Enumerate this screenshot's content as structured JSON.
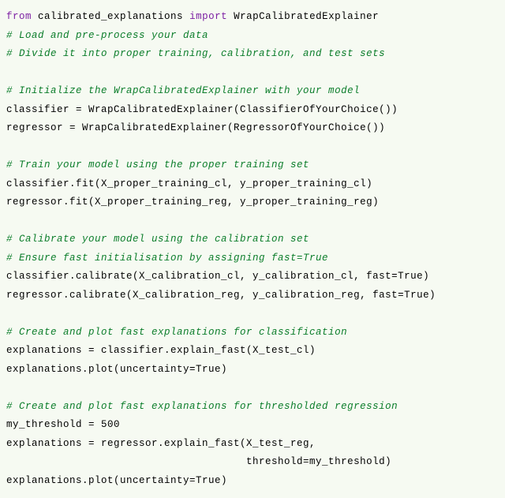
{
  "code": {
    "lines": [
      {
        "type": "import",
        "parts": {
          "from": "from",
          "mod": "calibrated_explanations",
          "imp": "import",
          "name": "WrapCalibratedExplainer"
        }
      },
      {
        "type": "comment",
        "text": "# Load and pre-process your data"
      },
      {
        "type": "comment",
        "text": "# Divide it into proper training, calibration, and test sets"
      },
      {
        "type": "blank",
        "text": ""
      },
      {
        "type": "comment",
        "text": "# Initialize the WrapCalibratedExplainer with your model"
      },
      {
        "type": "code",
        "text": "classifier = WrapCalibratedExplainer(ClassifierOfYourChoice())"
      },
      {
        "type": "code",
        "text": "regressor = WrapCalibratedExplainer(RegressorOfYourChoice())"
      },
      {
        "type": "blank",
        "text": ""
      },
      {
        "type": "comment",
        "text": "# Train your model using the proper training set"
      },
      {
        "type": "code",
        "text": "classifier.fit(X_proper_training_cl, y_proper_training_cl)"
      },
      {
        "type": "code",
        "text": "regressor.fit(X_proper_training_reg, y_proper_training_reg)"
      },
      {
        "type": "blank",
        "text": ""
      },
      {
        "type": "comment",
        "text": "# Calibrate your model using the calibration set"
      },
      {
        "type": "comment",
        "text": "# Ensure fast initialisation by assigning fast=True"
      },
      {
        "type": "code",
        "text": "classifier.calibrate(X_calibration_cl, y_calibration_cl, fast=True)"
      },
      {
        "type": "code",
        "text": "regressor.calibrate(X_calibration_reg, y_calibration_reg, fast=True)"
      },
      {
        "type": "blank",
        "text": ""
      },
      {
        "type": "comment",
        "text": "# Create and plot fast explanations for classification"
      },
      {
        "type": "code",
        "text": "explanations = classifier.explain_fast(X_test_cl)"
      },
      {
        "type": "code",
        "text": "explanations.plot(uncertainty=True)"
      },
      {
        "type": "blank",
        "text": ""
      },
      {
        "type": "comment",
        "text": "# Create and plot fast explanations for thresholded regression"
      },
      {
        "type": "code",
        "text": "my_threshold = 500"
      },
      {
        "type": "code",
        "text": "explanations = regressor.explain_fast(X_test_reg,"
      },
      {
        "type": "code",
        "text": "                                      threshold=my_threshold)"
      },
      {
        "type": "code",
        "text": "explanations.plot(uncertainty=True)"
      }
    ]
  }
}
